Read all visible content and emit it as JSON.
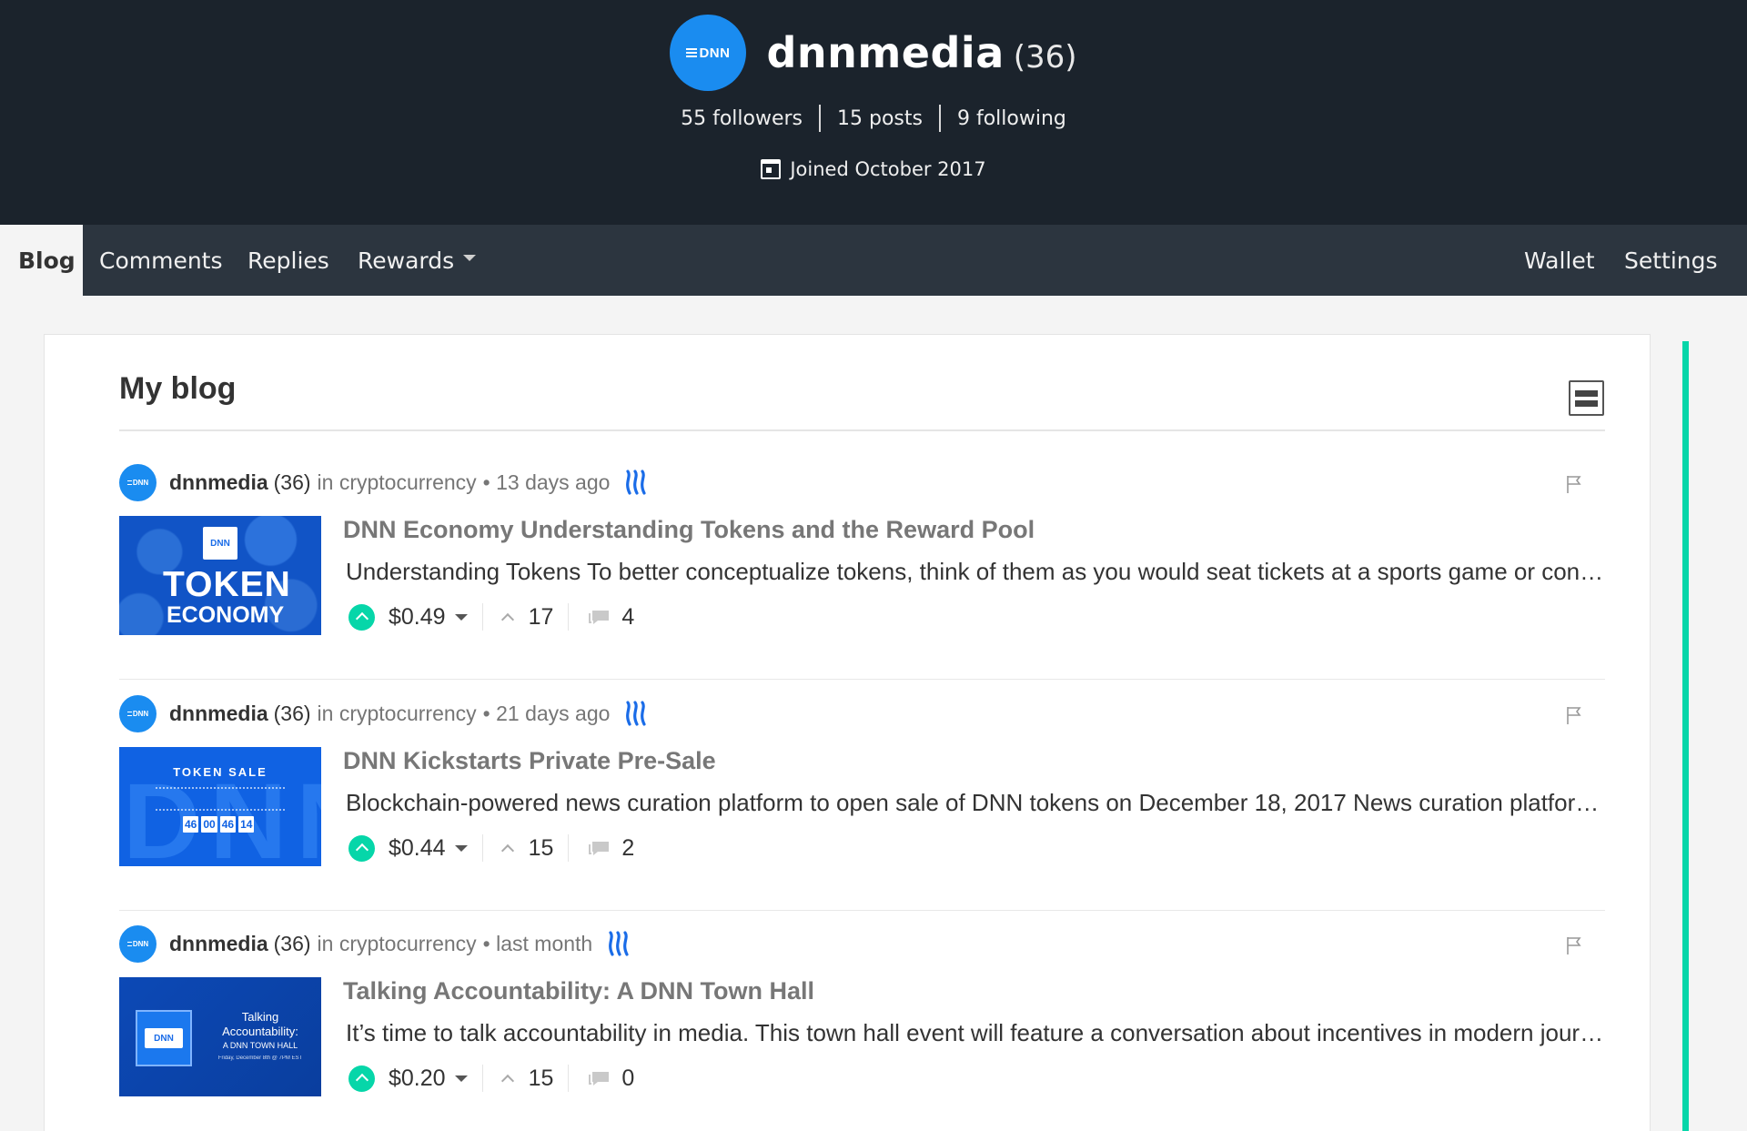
{
  "profile": {
    "avatar_text": "DNN",
    "name": "dnnmedia",
    "reputation": "(36)",
    "followers": "55 followers",
    "posts": "15 posts",
    "following": "9 following",
    "joined": "Joined October 2017"
  },
  "nav": {
    "tabs": [
      {
        "label": "Blog",
        "active": true
      },
      {
        "label": "Comments"
      },
      {
        "label": "Replies"
      },
      {
        "label": "Rewards"
      }
    ],
    "right": [
      {
        "label": "Wallet"
      },
      {
        "label": "Settings"
      }
    ]
  },
  "blog": {
    "title": "My blog",
    "posts": [
      {
        "author": "dnnmedia",
        "reputation": "(36)",
        "category": "in cryptocurrency",
        "time": "• 13 days ago",
        "title": "DNN Economy Understanding Tokens and the Reward Pool",
        "excerpt": "Understanding Tokens To better conceptualize tokens, think of them as you would seat tickets at a sports game or concert event.",
        "payout": "$0.49",
        "votes": "17",
        "comments": "4",
        "thumb": {
          "logo": "DNN",
          "line1": "TOKEN",
          "line2": "ECONOMY"
        }
      },
      {
        "author": "dnnmedia",
        "reputation": "(36)",
        "category": "in cryptocurrency",
        "time": "• 21 days ago",
        "title": "DNN Kickstarts Private Pre-Sale",
        "excerpt": "Blockchain-powered news curation platform to open sale of DNN tokens on December 18, 2017 News curation platform DNN announced today",
        "payout": "$0.44",
        "votes": "15",
        "comments": "2",
        "thumb": {
          "big": "DNN",
          "head": "TOKEN SALE",
          "digits": [
            "46",
            "00",
            "46",
            "14"
          ]
        }
      },
      {
        "author": "dnnmedia",
        "reputation": "(36)",
        "category": "in cryptocurrency",
        "time": "• last month",
        "title": "Talking Accountability: A DNN Town Hall",
        "excerpt": "It’s time to talk accountability in media. This town hall event will feature a conversation about incentives in modern journalism.",
        "payout": "$0.20",
        "votes": "15",
        "comments": "0",
        "thumb": {
          "logo": "DNN",
          "line1": "Talking",
          "line2": "Accountability:",
          "line3": "A DNN TOWN HALL",
          "line4": "Friday, December 8th @ 7PM EST"
        }
      }
    ]
  },
  "colors": {
    "header_bg": "#1b232c",
    "nav_bg": "#2c353f",
    "brand_blue": "#1a8cf0",
    "accent_green": "#06d6a9"
  },
  "icons": {
    "calendar": "calendar-icon",
    "view_toggle": "list-view-icon",
    "steem": "steem-icon",
    "flag": "flag-icon",
    "upvote": "upvote-icon",
    "votes": "chevron-up-icon",
    "comments": "comment-icon"
  }
}
